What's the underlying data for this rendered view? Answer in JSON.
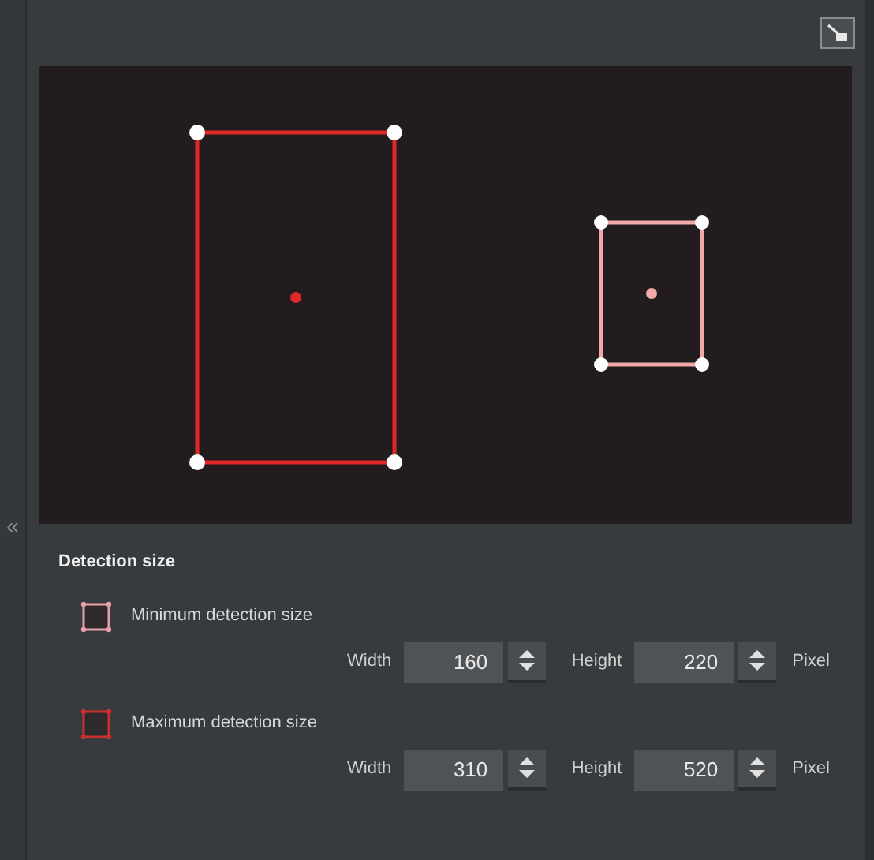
{
  "sidebar": {
    "collapse_glyph": "«"
  },
  "preview": {
    "boxes": [
      {
        "kind": "maximum",
        "color": "#e02828"
      },
      {
        "kind": "minimum",
        "color": "#f0a8a8"
      }
    ]
  },
  "detection_size": {
    "title": "Detection size",
    "options": [
      {
        "label": "Minimum detection size",
        "color": "#e7a0a8",
        "width": {
          "label": "Width",
          "value": "160"
        },
        "height": {
          "label": "Height",
          "value": "220"
        },
        "unit": "Pixel"
      },
      {
        "label": "Maximum detection size",
        "color": "#c83030",
        "width": {
          "label": "Width",
          "value": "310"
        },
        "height": {
          "label": "Height",
          "value": "520"
        },
        "unit": "Pixel"
      }
    ]
  }
}
